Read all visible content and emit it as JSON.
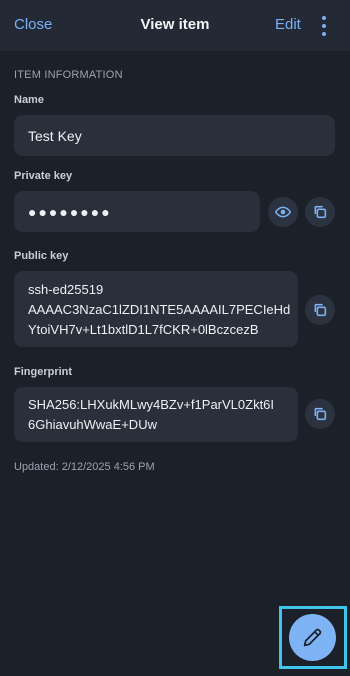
{
  "header": {
    "close_label": "Close",
    "title": "View item",
    "edit_label": "Edit",
    "more_icon": "kebab-menu-icon"
  },
  "item_information": {
    "section_title": "ITEM INFORMATION",
    "name": {
      "label": "Name",
      "value": "Test Key"
    },
    "private_key": {
      "label": "Private key",
      "value": "●●●●●●●●",
      "toggle_icon": "eye-icon",
      "copy_icon": "copy-icon"
    },
    "public_key": {
      "label": "Public key",
      "lines": [
        "ssh-ed25519",
        "AAAAC3NzaC1lZDI1NTE5AAAAIL7PECIeHd",
        "YtoiVH7v+Lt1bxtlD1L7fCKR+0lBczcezB"
      ],
      "copy_icon": "copy-icon"
    },
    "fingerprint": {
      "label": "Fingerprint",
      "lines": [
        "SHA256:LHXukMLwy4BZv+f1ParVL0Zkt6I",
        "6GhiavuhWwaE+DUw"
      ],
      "copy_icon": "copy-icon"
    },
    "updated": "Updated: 2/12/2025 4:56 PM"
  },
  "fab": {
    "icon": "pencil-icon"
  },
  "colors": {
    "background": "#1b2029",
    "header": "#232935",
    "field": "#2a303b",
    "accent": "#7bb0f2",
    "fab": "#7eb4f5",
    "highlight": "#3fc4ec"
  }
}
